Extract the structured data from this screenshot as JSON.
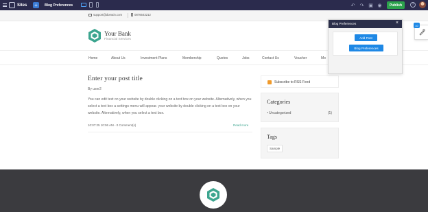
{
  "editor": {
    "brand": "Sites",
    "page_name": "Blog Preferences",
    "publish_label": "Publish",
    "help_label": "?",
    "add_label": "+"
  },
  "contact": {
    "email": "support@domain.com",
    "phone": "0876543212"
  },
  "site": {
    "name": "Your Bank",
    "tagline": "Financial Services",
    "brand_color": "#3ca58f"
  },
  "nav": {
    "items": [
      "Home",
      "About Us",
      "Investment Plans",
      "Membership",
      "Quotes",
      "Jobs",
      "Contact Us",
      "Voucher",
      "Mo"
    ]
  },
  "post": {
    "title": "Enter your post title",
    "author": "By user2",
    "body": "You can edit text on your website by double clicking on a text box on your website. Alternatively, when you select a text box a settings menu will appear. your website by double clicking on a text box on your website. Alternatively, when you select a text box.",
    "meta": "10:07:25 10:06 AM - 0 Comment(s)",
    "read_more": "Read more"
  },
  "sidebar": {
    "rss_label": "Subscribe to RSS Feed",
    "categories_title": "Categories",
    "categories": [
      {
        "name": "• Uncategorized",
        "count": "(1)"
      }
    ],
    "tags_title": "Tags",
    "tags": [
      "Sample"
    ]
  },
  "panel": {
    "title": "Blog Preferences",
    "close": "×",
    "add_post": "Add Post",
    "blog_prefs": "Blog Preferences"
  },
  "side_badge": "10"
}
